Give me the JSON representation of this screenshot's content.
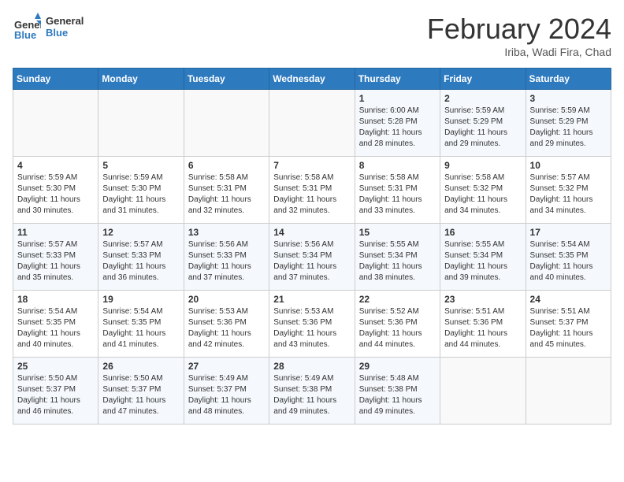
{
  "header": {
    "logo_general": "General",
    "logo_blue": "Blue",
    "month_title": "February 2024",
    "location": "Iriba, Wadi Fira, Chad"
  },
  "days_of_week": [
    "Sunday",
    "Monday",
    "Tuesday",
    "Wednesday",
    "Thursday",
    "Friday",
    "Saturday"
  ],
  "weeks": [
    [
      {
        "day": "",
        "sunrise": "",
        "sunset": "",
        "daylight": ""
      },
      {
        "day": "",
        "sunrise": "",
        "sunset": "",
        "daylight": ""
      },
      {
        "day": "",
        "sunrise": "",
        "sunset": "",
        "daylight": ""
      },
      {
        "day": "",
        "sunrise": "",
        "sunset": "",
        "daylight": ""
      },
      {
        "day": "1",
        "sunrise": "Sunrise: 6:00 AM",
        "sunset": "Sunset: 5:28 PM",
        "daylight": "Daylight: 11 hours and 28 minutes."
      },
      {
        "day": "2",
        "sunrise": "Sunrise: 5:59 AM",
        "sunset": "Sunset: 5:29 PM",
        "daylight": "Daylight: 11 hours and 29 minutes."
      },
      {
        "day": "3",
        "sunrise": "Sunrise: 5:59 AM",
        "sunset": "Sunset: 5:29 PM",
        "daylight": "Daylight: 11 hours and 29 minutes."
      }
    ],
    [
      {
        "day": "4",
        "sunrise": "Sunrise: 5:59 AM",
        "sunset": "Sunset: 5:30 PM",
        "daylight": "Daylight: 11 hours and 30 minutes."
      },
      {
        "day": "5",
        "sunrise": "Sunrise: 5:59 AM",
        "sunset": "Sunset: 5:30 PM",
        "daylight": "Daylight: 11 hours and 31 minutes."
      },
      {
        "day": "6",
        "sunrise": "Sunrise: 5:58 AM",
        "sunset": "Sunset: 5:31 PM",
        "daylight": "Daylight: 11 hours and 32 minutes."
      },
      {
        "day": "7",
        "sunrise": "Sunrise: 5:58 AM",
        "sunset": "Sunset: 5:31 PM",
        "daylight": "Daylight: 11 hours and 32 minutes."
      },
      {
        "day": "8",
        "sunrise": "Sunrise: 5:58 AM",
        "sunset": "Sunset: 5:31 PM",
        "daylight": "Daylight: 11 hours and 33 minutes."
      },
      {
        "day": "9",
        "sunrise": "Sunrise: 5:58 AM",
        "sunset": "Sunset: 5:32 PM",
        "daylight": "Daylight: 11 hours and 34 minutes."
      },
      {
        "day": "10",
        "sunrise": "Sunrise: 5:57 AM",
        "sunset": "Sunset: 5:32 PM",
        "daylight": "Daylight: 11 hours and 34 minutes."
      }
    ],
    [
      {
        "day": "11",
        "sunrise": "Sunrise: 5:57 AM",
        "sunset": "Sunset: 5:33 PM",
        "daylight": "Daylight: 11 hours and 35 minutes."
      },
      {
        "day": "12",
        "sunrise": "Sunrise: 5:57 AM",
        "sunset": "Sunset: 5:33 PM",
        "daylight": "Daylight: 11 hours and 36 minutes."
      },
      {
        "day": "13",
        "sunrise": "Sunrise: 5:56 AM",
        "sunset": "Sunset: 5:33 PM",
        "daylight": "Daylight: 11 hours and 37 minutes."
      },
      {
        "day": "14",
        "sunrise": "Sunrise: 5:56 AM",
        "sunset": "Sunset: 5:34 PM",
        "daylight": "Daylight: 11 hours and 37 minutes."
      },
      {
        "day": "15",
        "sunrise": "Sunrise: 5:55 AM",
        "sunset": "Sunset: 5:34 PM",
        "daylight": "Daylight: 11 hours and 38 minutes."
      },
      {
        "day": "16",
        "sunrise": "Sunrise: 5:55 AM",
        "sunset": "Sunset: 5:34 PM",
        "daylight": "Daylight: 11 hours and 39 minutes."
      },
      {
        "day": "17",
        "sunrise": "Sunrise: 5:54 AM",
        "sunset": "Sunset: 5:35 PM",
        "daylight": "Daylight: 11 hours and 40 minutes."
      }
    ],
    [
      {
        "day": "18",
        "sunrise": "Sunrise: 5:54 AM",
        "sunset": "Sunset: 5:35 PM",
        "daylight": "Daylight: 11 hours and 40 minutes."
      },
      {
        "day": "19",
        "sunrise": "Sunrise: 5:54 AM",
        "sunset": "Sunset: 5:35 PM",
        "daylight": "Daylight: 11 hours and 41 minutes."
      },
      {
        "day": "20",
        "sunrise": "Sunrise: 5:53 AM",
        "sunset": "Sunset: 5:36 PM",
        "daylight": "Daylight: 11 hours and 42 minutes."
      },
      {
        "day": "21",
        "sunrise": "Sunrise: 5:53 AM",
        "sunset": "Sunset: 5:36 PM",
        "daylight": "Daylight: 11 hours and 43 minutes."
      },
      {
        "day": "22",
        "sunrise": "Sunrise: 5:52 AM",
        "sunset": "Sunset: 5:36 PM",
        "daylight": "Daylight: 11 hours and 44 minutes."
      },
      {
        "day": "23",
        "sunrise": "Sunrise: 5:51 AM",
        "sunset": "Sunset: 5:36 PM",
        "daylight": "Daylight: 11 hours and 44 minutes."
      },
      {
        "day": "24",
        "sunrise": "Sunrise: 5:51 AM",
        "sunset": "Sunset: 5:37 PM",
        "daylight": "Daylight: 11 hours and 45 minutes."
      }
    ],
    [
      {
        "day": "25",
        "sunrise": "Sunrise: 5:50 AM",
        "sunset": "Sunset: 5:37 PM",
        "daylight": "Daylight: 11 hours and 46 minutes."
      },
      {
        "day": "26",
        "sunrise": "Sunrise: 5:50 AM",
        "sunset": "Sunset: 5:37 PM",
        "daylight": "Daylight: 11 hours and 47 minutes."
      },
      {
        "day": "27",
        "sunrise": "Sunrise: 5:49 AM",
        "sunset": "Sunset: 5:37 PM",
        "daylight": "Daylight: 11 hours and 48 minutes."
      },
      {
        "day": "28",
        "sunrise": "Sunrise: 5:49 AM",
        "sunset": "Sunset: 5:38 PM",
        "daylight": "Daylight: 11 hours and 49 minutes."
      },
      {
        "day": "29",
        "sunrise": "Sunrise: 5:48 AM",
        "sunset": "Sunset: 5:38 PM",
        "daylight": "Daylight: 11 hours and 49 minutes."
      },
      {
        "day": "",
        "sunrise": "",
        "sunset": "",
        "daylight": ""
      },
      {
        "day": "",
        "sunrise": "",
        "sunset": "",
        "daylight": ""
      }
    ]
  ]
}
